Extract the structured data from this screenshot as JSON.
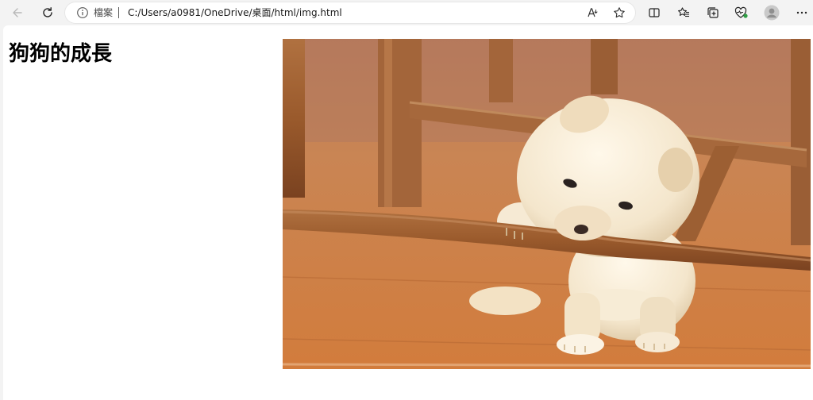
{
  "browser": {
    "address_bar": {
      "file_label": "檔案",
      "url": "C:/Users/a0981/OneDrive/桌面/html/img.html"
    },
    "icons": [
      "back-icon",
      "refresh-icon",
      "info-icon",
      "read-aloud-icon",
      "favorite-star-icon",
      "split-screen-icon",
      "favorites-icon",
      "collections-icon",
      "browser-essentials-icon",
      "profile-avatar-icon",
      "more-menu-icon"
    ]
  },
  "page": {
    "title": "狗狗的成長",
    "image_subject": "cream puppy chewing a wooden chair rung on a wooden floor"
  }
}
